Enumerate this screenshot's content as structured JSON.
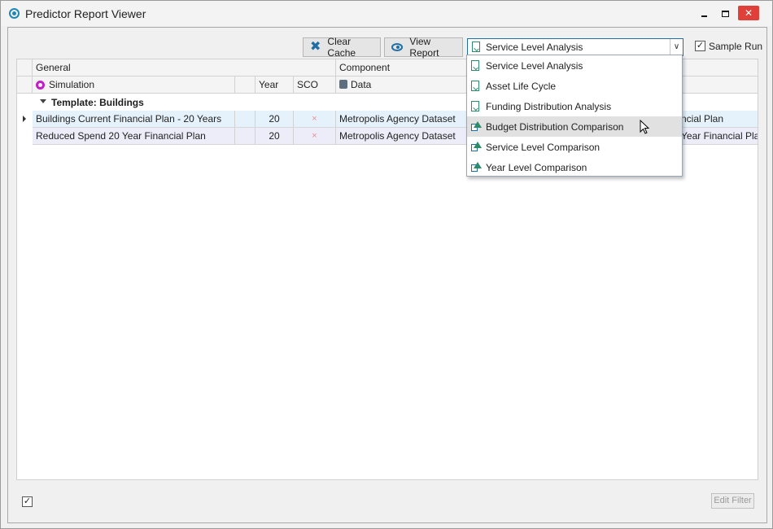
{
  "window": {
    "title": "Predictor Report Viewer"
  },
  "toolbar": {
    "clear_cache_label": "Clear Cache",
    "view_report_label": "View Report",
    "report_selected": "Service Level Analysis",
    "sample_run_label": "Sample Run",
    "sample_run_checked": "✓"
  },
  "grid": {
    "bands": {
      "general": "General",
      "component": "Component"
    },
    "columns": {
      "simulation": "Simulation",
      "year": "Year",
      "sco": "SCO",
      "data": "Data"
    },
    "group_label": "Template: Buildings",
    "rows": [
      {
        "simulation": "Buildings Current Financial Plan - 20 Years",
        "year": "20",
        "sco": "×",
        "data": "Metropolis Agency Dataset",
        "extra": "ncial Plan"
      },
      {
        "simulation": "Reduced Spend 20 Year Financial Plan",
        "year": "20",
        "sco": "×",
        "data": "Metropolis Agency Dataset",
        "extra": "Year Financial Plan"
      }
    ]
  },
  "menu": {
    "items": [
      {
        "label": "Service Level Analysis",
        "icon": "report-doc-icon"
      },
      {
        "label": "Asset Life Cycle",
        "icon": "report-doc-icon"
      },
      {
        "label": "Funding Distribution Analysis",
        "icon": "report-doc-icon"
      },
      {
        "label": "Budget Distribution Comparison",
        "icon": "comparison-icon"
      },
      {
        "label": "Service Level Comparison",
        "icon": "comparison-icon"
      },
      {
        "label": "Year Level Comparison",
        "icon": "comparison-icon"
      }
    ],
    "highlighted_index": 3
  },
  "footer": {
    "filter_checked": "✓",
    "edit_filter_label": "Edit Filter"
  },
  "colors": {
    "accent": "#1e6fa5",
    "close": "#e0403a",
    "simulation_icon": "#c21fc7",
    "row_selected": "#e6f2fb",
    "row_alt": "#ededfa"
  }
}
